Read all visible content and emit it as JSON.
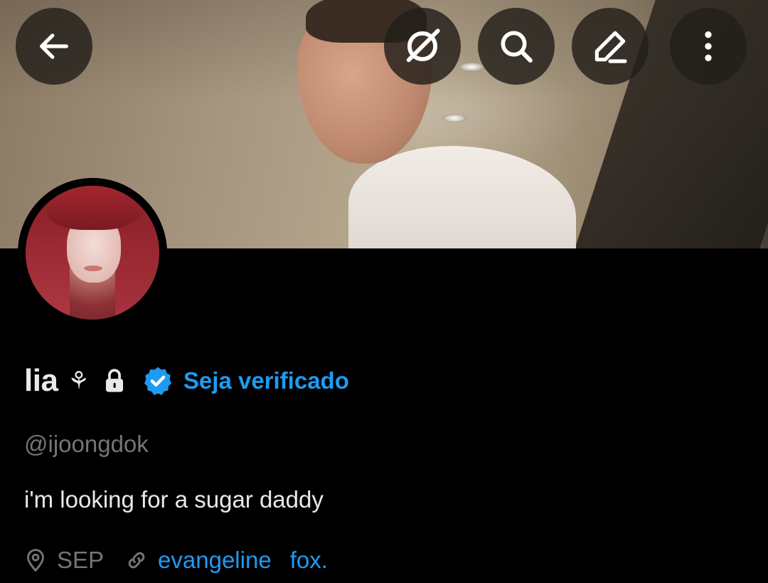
{
  "header": {
    "buttons": [
      {
        "name": "back",
        "icon": "arrow-left-icon"
      },
      {
        "name": "grok",
        "icon": "grok-icon"
      },
      {
        "name": "search",
        "icon": "search-icon"
      },
      {
        "name": "edit",
        "icon": "pencil-icon"
      },
      {
        "name": "more",
        "icon": "more-vertical-icon"
      }
    ]
  },
  "profile": {
    "display_name": "lia",
    "name_emoji": "⚘",
    "verify_cta": "Seja verificado",
    "handle": "@ijoongdok",
    "bio": "i'm looking for a sugar daddy",
    "location": "SEP",
    "link_text_1": "evangeline",
    "link_text_2": "fox.",
    "protected": true,
    "verified_badge_color": "#1d9bf0"
  },
  "colors": {
    "background": "#000000",
    "text_primary": "#e7e9ea",
    "text_secondary": "#71767b",
    "accent": "#1d9bf0"
  }
}
